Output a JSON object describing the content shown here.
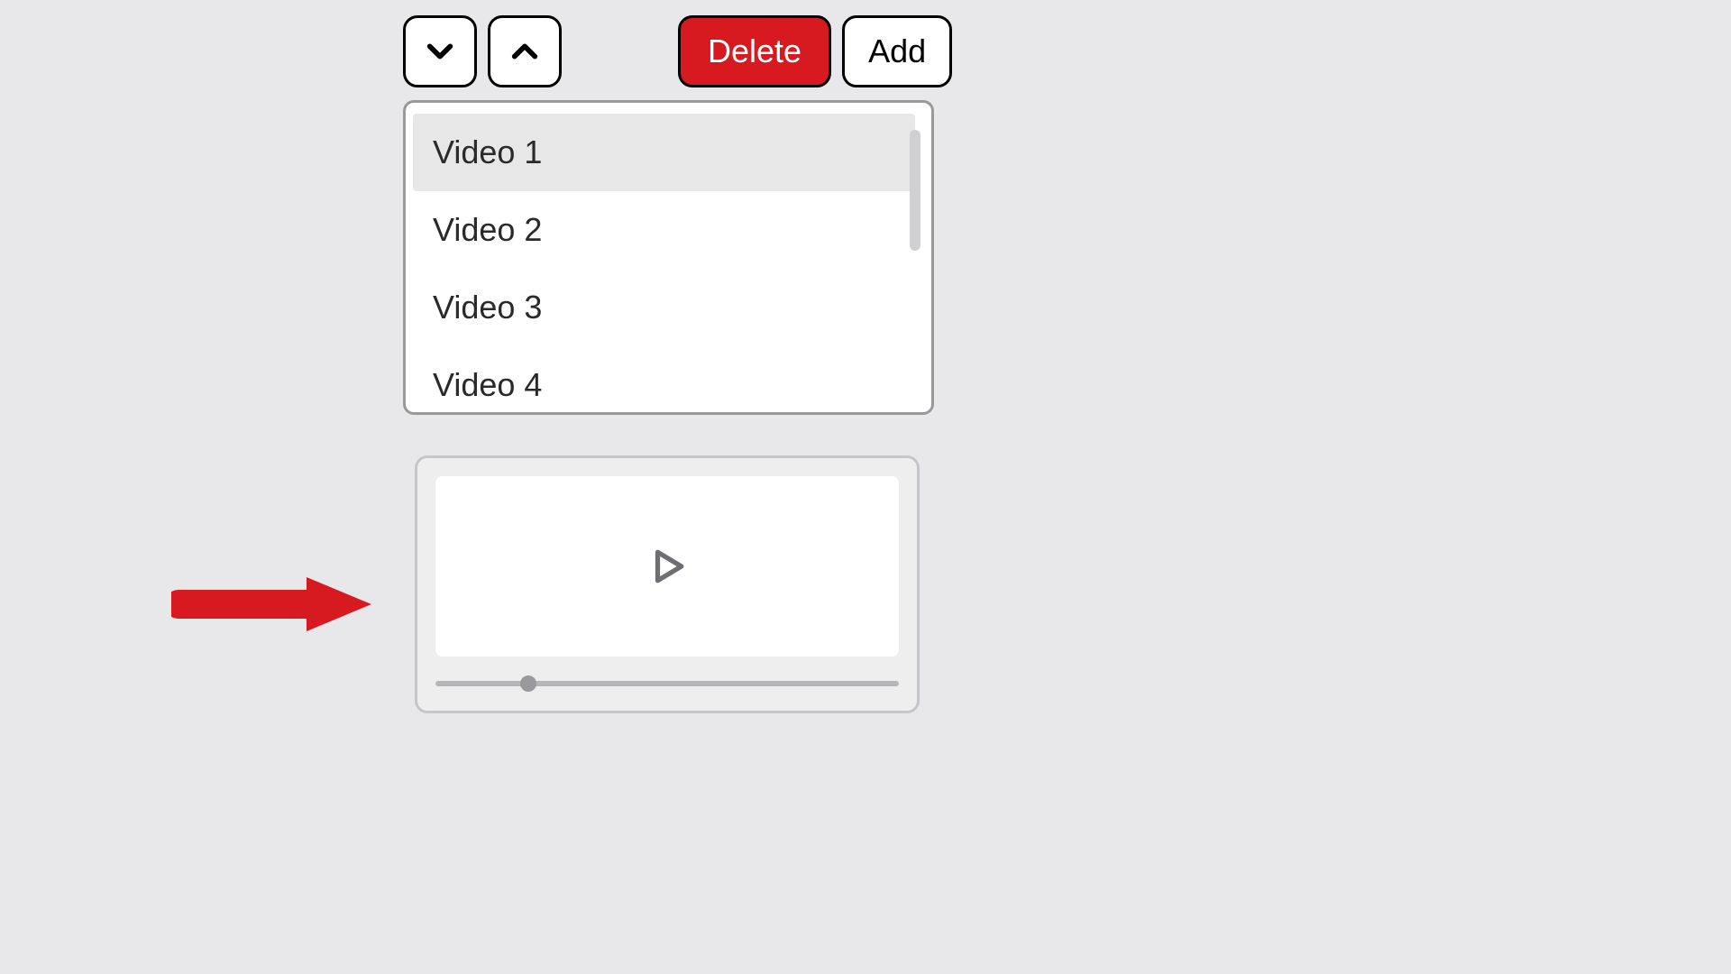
{
  "toolbar": {
    "move_down_label": "Move Down",
    "move_up_label": "Move Up",
    "delete_label": "Delete",
    "add_label": "Add"
  },
  "playlist": {
    "items": [
      {
        "label": "Video 1",
        "selected": true
      },
      {
        "label": "Video 2",
        "selected": false
      },
      {
        "label": "Video 3",
        "selected": false
      },
      {
        "label": "Video 4",
        "selected": false
      }
    ]
  },
  "player": {
    "progress_percent": 20
  },
  "colors": {
    "accent_red": "#d71920",
    "bg": "#e8e8ea"
  }
}
